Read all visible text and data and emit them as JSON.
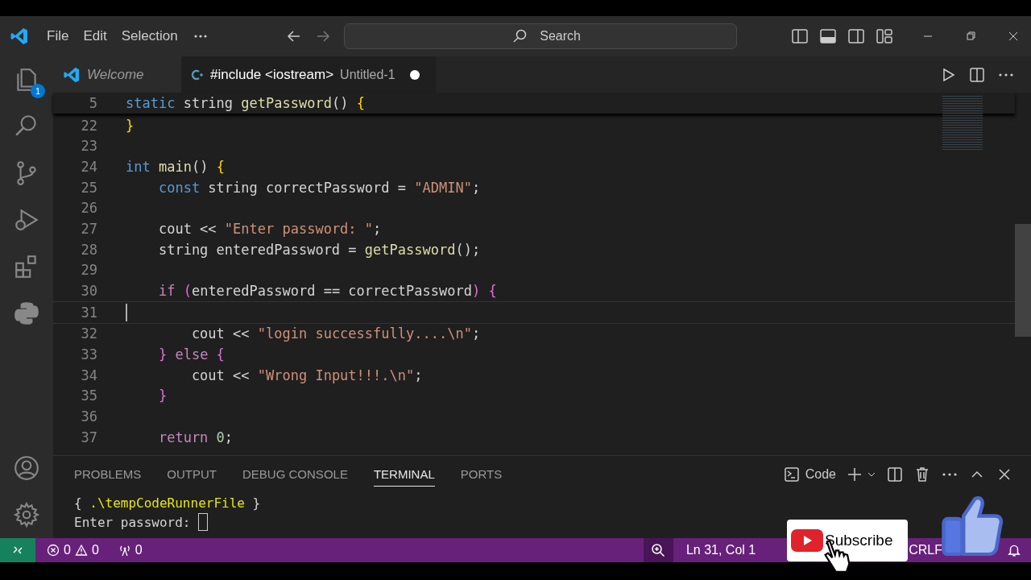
{
  "menu": [
    "File",
    "Edit",
    "Selection"
  ],
  "search": {
    "placeholder": "Search"
  },
  "activity_bar": {
    "explorer_badge": "1"
  },
  "tabs": [
    {
      "label": "Welcome",
      "kind": "welcome",
      "preview": true,
      "selected": false,
      "dirty": false
    },
    {
      "label": "#include <iostream>",
      "description": "Untitled-1",
      "kind": "cpp",
      "preview": false,
      "selected": true,
      "dirty": true
    }
  ],
  "editor": {
    "sticky_line": {
      "num": "5",
      "tokens": [
        {
          "t": "static",
          "kind": "kw"
        },
        {
          "t": " string ",
          "kind": "plain"
        },
        {
          "t": "getPassword",
          "kind": "fn"
        },
        {
          "t": "()",
          "kind": "plain"
        },
        {
          "t": " {",
          "kind": "b1"
        }
      ]
    },
    "lines": [
      {
        "num": "22",
        "current": false,
        "tokens": [
          {
            "t": "}",
            "kind": "b1"
          }
        ]
      },
      {
        "num": "23",
        "current": false
      },
      {
        "num": "24",
        "current": false,
        "tokens": [
          {
            "t": "int",
            "kind": "kw"
          },
          {
            "t": " main",
            "kind": "fn"
          },
          {
            "t": "()",
            "kind": "plain"
          },
          {
            "t": " {",
            "kind": "b1"
          }
        ]
      },
      {
        "num": "25",
        "current": false,
        "tokens": [
          {
            "t": "    const",
            "kind": "kw"
          },
          {
            "t": " string correctPassword = ",
            "kind": "plain"
          },
          {
            "t": "\"ADMIN\"",
            "kind": "str"
          },
          {
            "t": ";",
            "kind": "plain"
          }
        ]
      },
      {
        "num": "26",
        "current": false
      },
      {
        "num": "27",
        "current": false,
        "tokens": [
          {
            "t": "    cout << ",
            "kind": "plain"
          },
          {
            "t": "\"Enter password: \"",
            "kind": "str"
          },
          {
            "t": ";",
            "kind": "plain"
          }
        ]
      },
      {
        "num": "28",
        "current": false,
        "tokens": [
          {
            "t": "    string enteredPassword = ",
            "kind": "plain"
          },
          {
            "t": "getPassword",
            "kind": "fn"
          },
          {
            "t": "();",
            "kind": "plain"
          }
        ]
      },
      {
        "num": "29",
        "current": false
      },
      {
        "num": "30",
        "current": false,
        "tokens": [
          {
            "t": "    if",
            "kind": "ctl"
          },
          {
            "t": " (",
            "kind": "b2"
          },
          {
            "t": "enteredPassword == correctPassword",
            "kind": "plain"
          },
          {
            "t": ")",
            "kind": "b2"
          },
          {
            "t": " {",
            "kind": "b2"
          }
        ]
      },
      {
        "num": "31",
        "current": true
      },
      {
        "num": "32",
        "current": false,
        "tokens": [
          {
            "t": "        cout << ",
            "kind": "plain"
          },
          {
            "t": "\"login successfully....\\n\"",
            "kind": "str"
          },
          {
            "t": ";",
            "kind": "plain"
          }
        ]
      },
      {
        "num": "33",
        "current": false,
        "tokens": [
          {
            "t": "    }",
            "kind": "b2"
          },
          {
            "t": " else",
            "kind": "ctl"
          },
          {
            "t": " {",
            "kind": "b2"
          }
        ]
      },
      {
        "num": "34",
        "current": false,
        "tokens": [
          {
            "t": "        cout << ",
            "kind": "plain"
          },
          {
            "t": "\"Wrong Input!!!.\\n\"",
            "kind": "str"
          },
          {
            "t": ";",
            "kind": "plain"
          }
        ]
      },
      {
        "num": "35",
        "current": false,
        "tokens": [
          {
            "t": "    }",
            "kind": "b2"
          }
        ]
      },
      {
        "num": "36",
        "current": false
      },
      {
        "num": "37",
        "current": false,
        "tokens": [
          {
            "t": "    return",
            "kind": "ctl"
          },
          {
            "t": " 0",
            "kind": "num"
          },
          {
            "t": ";",
            "kind": "plain"
          }
        ]
      }
    ]
  },
  "panel": {
    "tabs": [
      {
        "label": "PROBLEMS",
        "selected": false
      },
      {
        "label": "OUTPUT",
        "selected": false
      },
      {
        "label": "DEBUG CONSOLE",
        "selected": false
      },
      {
        "label": "TERMINAL",
        "selected": true
      },
      {
        "label": "PORTS",
        "selected": false
      }
    ],
    "terminal_name": "Code",
    "terminal": [
      {
        "tokens": [
          {
            "t": "{ ",
            "kind": "plain"
          },
          {
            "t": ".\\tempCodeRunnerFile",
            "kind": "path"
          },
          {
            "t": " }",
            "kind": "plain"
          }
        ]
      },
      {
        "tokens": [
          {
            "t": "Enter password: ",
            "kind": "plain"
          }
        ],
        "cursor": true
      }
    ]
  },
  "status_bar": {
    "errors": "0",
    "warnings": "0",
    "ports": "0",
    "position": "Ln 31, Col 1",
    "eol": "CRLF"
  },
  "overlay": {
    "subscribe": "Subscribe"
  }
}
